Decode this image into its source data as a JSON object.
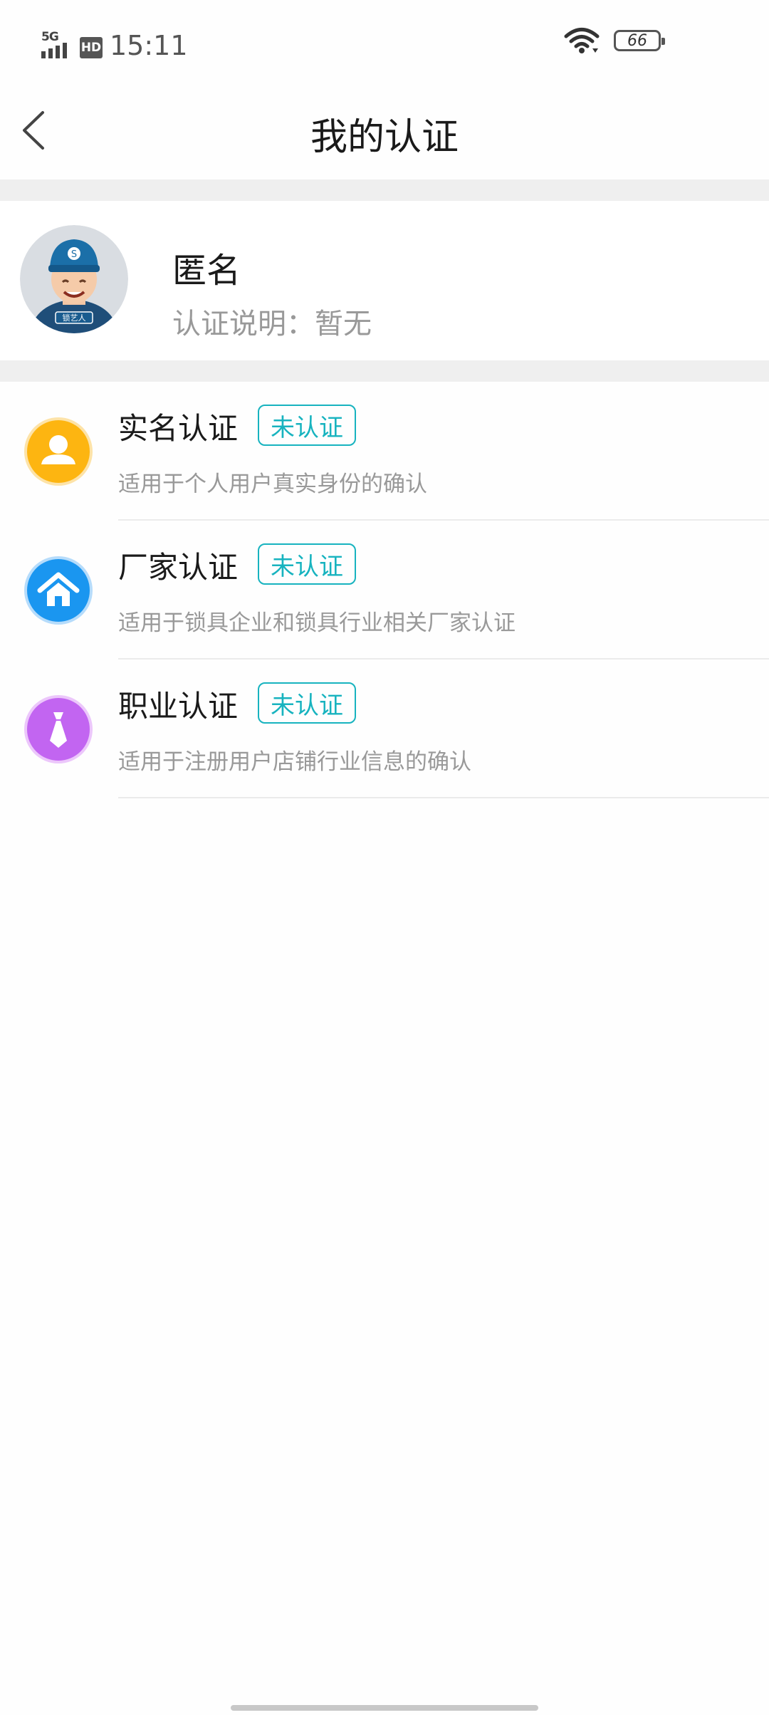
{
  "status_bar": {
    "network": "5G",
    "hd": "HD",
    "time": "15:11",
    "battery": "66",
    "wifi_icon": "wifi-icon"
  },
  "nav": {
    "title": "我的认证",
    "back_icon": "back-chevron-icon"
  },
  "profile": {
    "name": "匿名",
    "note": "认证说明：暂无",
    "avatar_text": "锁艺人"
  },
  "certifications": [
    {
      "title": "实名认证",
      "status": "未认证",
      "description": "适用于个人用户真实身份的确认",
      "icon": "person-icon",
      "color": "#fdb511"
    },
    {
      "title": "厂家认证",
      "status": "未认证",
      "description": "适用于锁具企业和锁具行业相关厂家认证",
      "icon": "house-icon",
      "color": "#1a96f0"
    },
    {
      "title": "职业认证",
      "status": "未认证",
      "description": "适用于注册用户店铺行业信息的确认",
      "icon": "tie-icon",
      "color": "#c265f1"
    }
  ],
  "colors": {
    "badge": "#17b3bf",
    "separator": "#efefef"
  }
}
